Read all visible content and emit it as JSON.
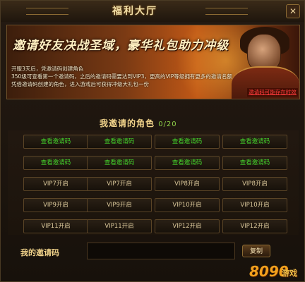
{
  "window": {
    "title": "福利大厅",
    "close_icon": "close-icon"
  },
  "banner": {
    "headline": "邀请好友决战圣域，豪华礼包助力冲级",
    "lines": [
      "开服3天后，凭邀请码创建角色",
      "350级可查看第一个邀请码，之后的邀请码需要达到VIP3，更高的VIP等级拥有更多的邀请名额",
      "凭借邀请码创建的角色，进入游戏后可获得冲级大礼包一份"
    ],
    "link": "邀请码可能存在时效"
  },
  "invited": {
    "title": "我邀请的角色",
    "count": "0/20",
    "rows": [
      [
        "查看邀请码",
        "查看邀请码",
        "查看邀请码",
        "查看邀请码"
      ],
      [
        "查看邀请码",
        "查看邀请码",
        "查看邀请码",
        "查看邀请码"
      ],
      [
        "VIP7开启",
        "VIP7开启",
        "VIP8开启",
        "VIP8开启"
      ],
      [
        "VIP9开启",
        "VIP9开启",
        "VIP10开启",
        "VIP10开启"
      ],
      [
        "VIP11开启",
        "VIP11开启",
        "VIP12开启",
        "VIP12开启"
      ]
    ]
  },
  "invite_code": {
    "label": "我的邀请码",
    "value": "",
    "copy_label": "复制"
  },
  "watermark": {
    "number": "8090",
    "word": "游戏"
  },
  "colors": {
    "unlocked_text": "#43d12b",
    "locked_text": "#d9c79a",
    "accent": "#f0d28a",
    "link": "#ff3b3b"
  }
}
